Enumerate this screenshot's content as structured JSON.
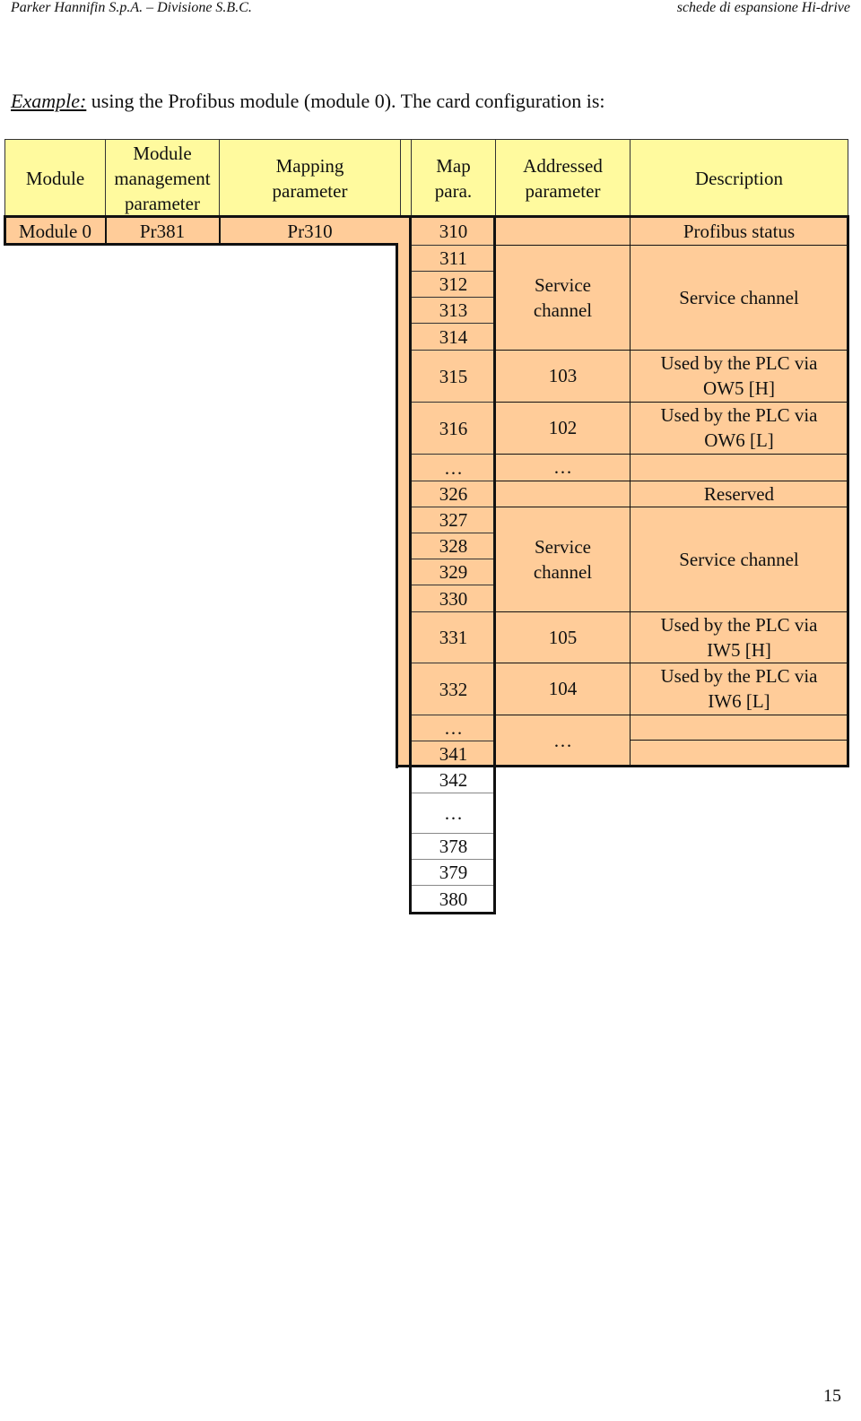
{
  "header": {
    "left": "Parker Hannifin S.p.A. – Divisione S.B.C.",
    "right": "schede di espansione Hi-drive"
  },
  "intro": {
    "label": "Example:",
    "text": " using the Profibus module (module 0). The card configuration is:"
  },
  "table": {
    "headers": {
      "module": "Module",
      "management_l1": "Module",
      "management_l2": "management",
      "management_l3": "parameter",
      "mapping_l1": "Mapping",
      "mapping_l2": "parameter",
      "map_l1": "Map",
      "map_l2": "para.",
      "addressed_l1": "Addressed",
      "addressed_l2": "parameter",
      "description": "Description"
    },
    "first_row": {
      "module": "Module 0",
      "management": "Pr381",
      "mapping": "Pr310",
      "map": "310",
      "addressed": "",
      "description": "Profibus status"
    },
    "map_values": [
      "311",
      "312",
      "313",
      "314",
      "315",
      "316",
      "…",
      "326",
      "327",
      "328",
      "329",
      "330",
      "331",
      "332",
      "…",
      "341"
    ],
    "extra_map_values": [
      "342",
      "…",
      "378",
      "379",
      "380"
    ],
    "addressed": {
      "service1_l1": "Service",
      "service1_l2": "channel",
      "r315": "103",
      "r316": "102",
      "dots1": "…",
      "service2_l1": "Service",
      "service2_l2": "channel",
      "r331": "105",
      "r332": "104",
      "dots2": "…"
    },
    "descriptions": {
      "service1": "Service channel",
      "r315_l1": "Used by the PLC via",
      "r315_l2": "OW5 [H]",
      "r316_l1": "Used by the PLC via",
      "r316_l2": "OW6 [L]",
      "reserved": "Reserved",
      "service2": "Service channel",
      "r331_l1": "Used by the PLC via",
      "r331_l2": "IW5 [H]",
      "r332_l1": "Used by the PLC via",
      "r332_l2": "IW6 [L]"
    }
  },
  "page_number": "15"
}
